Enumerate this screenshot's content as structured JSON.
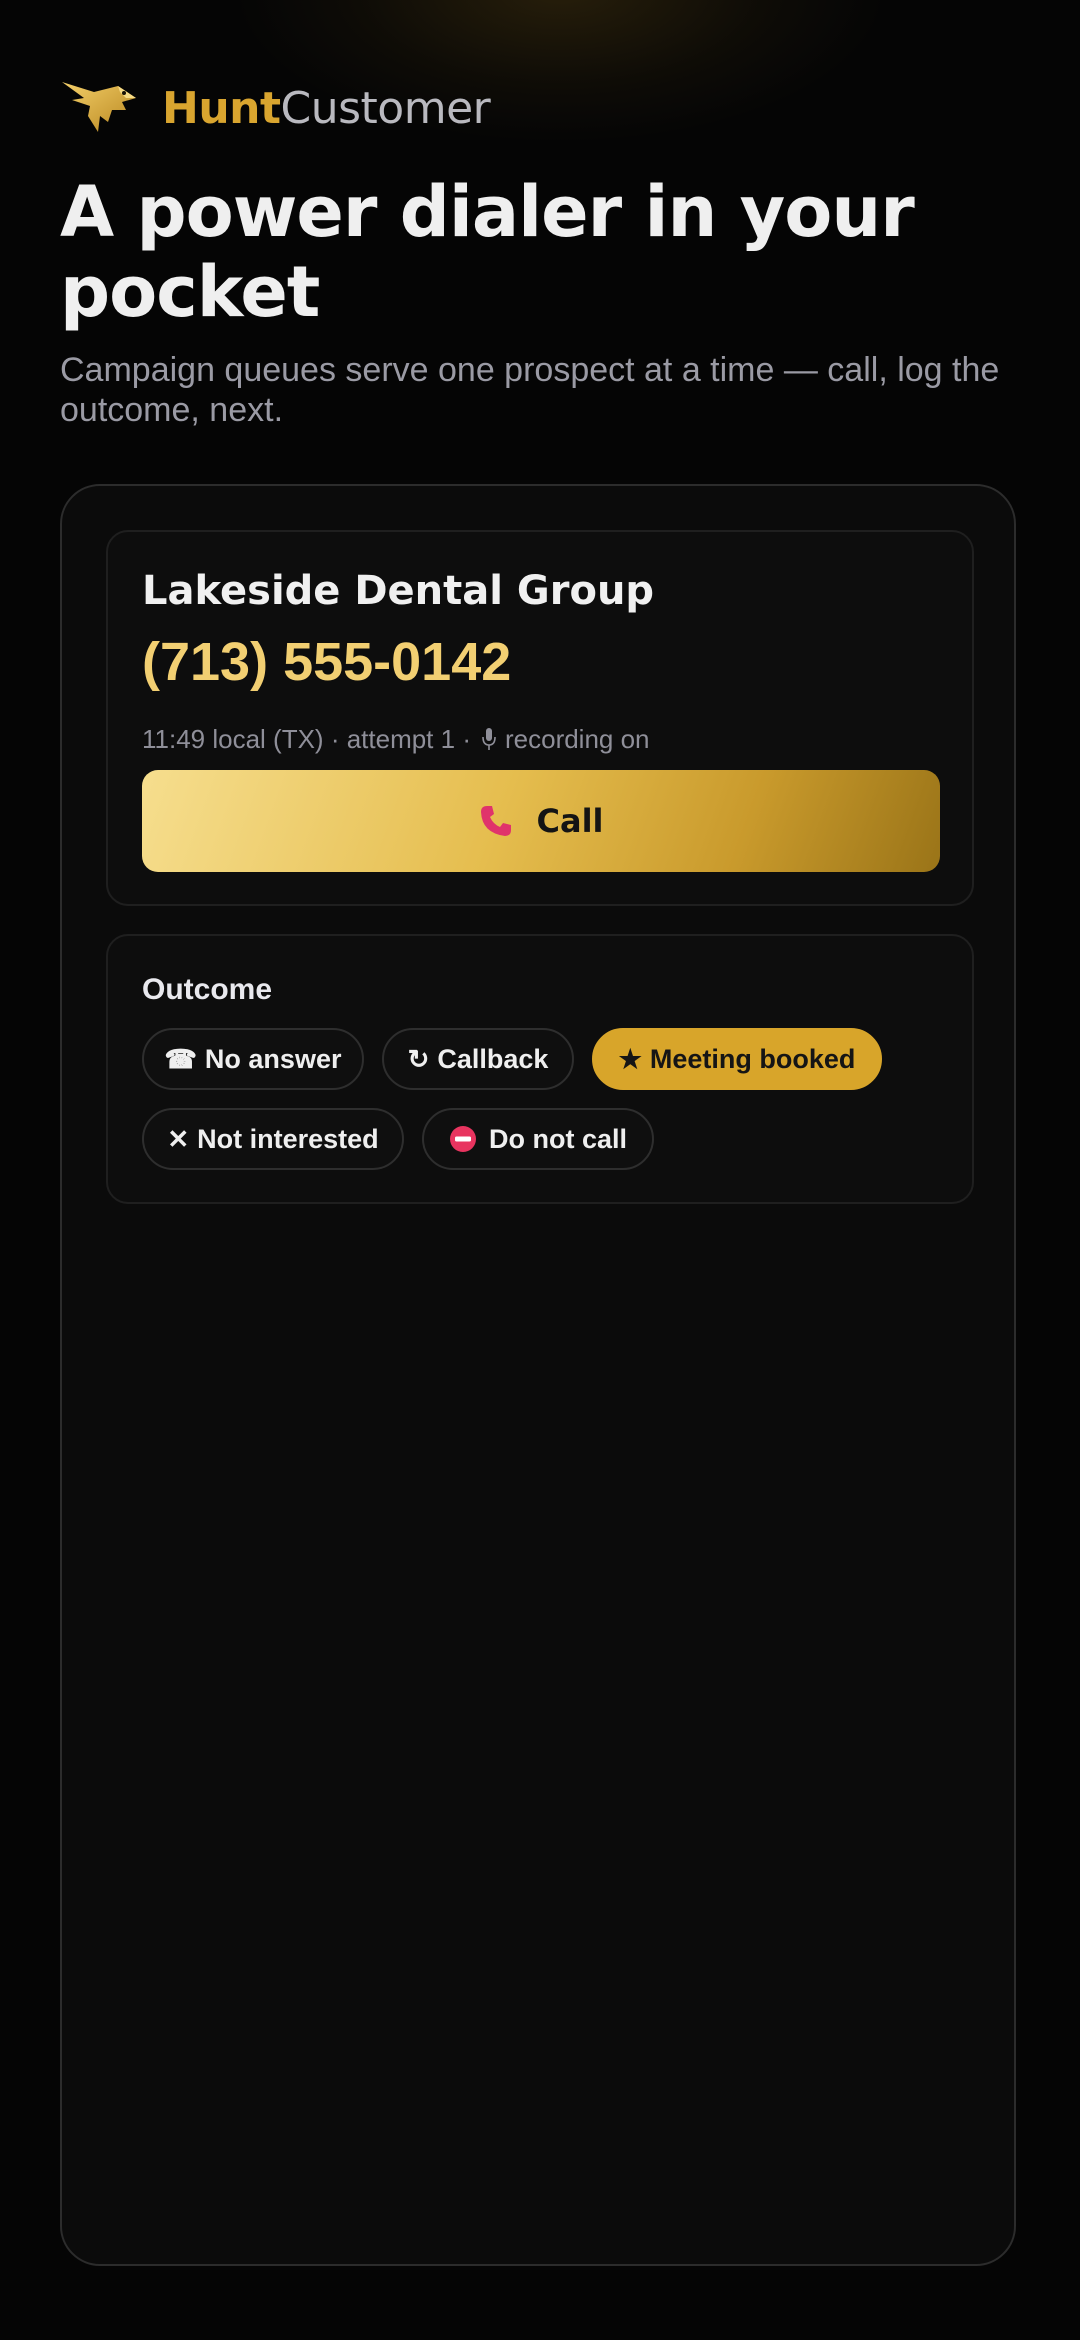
{
  "brand": {
    "name_part1": "Hunt",
    "name_part2": "Customer",
    "logo_icon": "gold-eagle-logo-icon",
    "accent_color": "#d9a52f"
  },
  "hero": {
    "headline": "A power dialer in your pocket",
    "subline": "Campaign queues serve one prospect at a time — call, log the outcome, next."
  },
  "prospect": {
    "name": "Lakeside Dental Group",
    "phone": "(713) 555-0142",
    "meta_prefix": "11:49 local (TX) · attempt 1 ·",
    "meta_recording": "recording on",
    "recording_icon": "microphone-icon",
    "call_label": "Call",
    "call_icon": "phone-icon",
    "phone_color": "#f2cf72"
  },
  "outcome": {
    "title": "Outcome",
    "options": [
      {
        "label": "No answer",
        "icon": "☎",
        "icon_name": "telephone-icon",
        "selected": false
      },
      {
        "label": "Callback",
        "icon": "↻",
        "icon_name": "refresh-icon",
        "selected": false
      },
      {
        "label": "Meeting booked",
        "icon": "★",
        "icon_name": "star-icon",
        "selected": true
      },
      {
        "label": "Not interested",
        "icon": "✕",
        "icon_name": "close-icon",
        "selected": false
      },
      {
        "label": "Do not call",
        "icon": "",
        "icon_name": "no-entry-icon",
        "selected": false
      }
    ],
    "selected_color": "#d8a52a"
  }
}
